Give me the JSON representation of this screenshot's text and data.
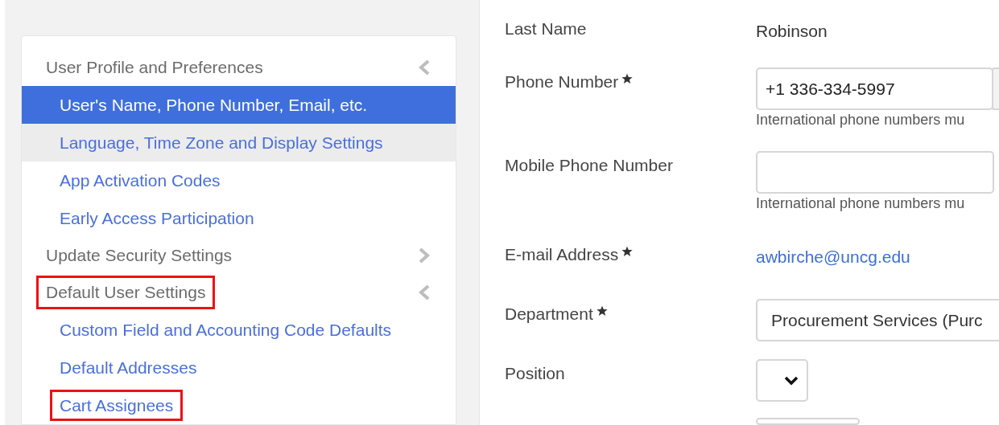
{
  "sidebar": {
    "sections": [
      {
        "title": "User Profile and Preferences",
        "expanded": true,
        "outlined": false,
        "items": [
          {
            "label": "User's Name, Phone Number, Email, etc.",
            "selected": true,
            "hovered": false,
            "outlined": false
          },
          {
            "label": "Language, Time Zone and Display Settings",
            "selected": false,
            "hovered": true,
            "outlined": false
          },
          {
            "label": "App Activation Codes",
            "selected": false,
            "hovered": false,
            "outlined": false
          },
          {
            "label": "Early Access Participation",
            "selected": false,
            "hovered": false,
            "outlined": false
          }
        ]
      },
      {
        "title": "Update Security Settings",
        "expanded": false,
        "outlined": false
      },
      {
        "title": "Default User Settings",
        "expanded": true,
        "outlined": true,
        "items": [
          {
            "label": "Custom Field and Accounting Code Defaults",
            "selected": false,
            "hovered": false,
            "outlined": false
          },
          {
            "label": "Default Addresses",
            "selected": false,
            "hovered": false,
            "outlined": false
          },
          {
            "label": "Cart Assignees",
            "selected": false,
            "hovered": false,
            "outlined": true
          }
        ]
      }
    ]
  },
  "form": {
    "fields": [
      {
        "kind": "text",
        "label": "Last Name",
        "value": "Robinson"
      },
      {
        "kind": "phone",
        "label": "Phone Number",
        "required": true,
        "value": "+1 336-334-5997",
        "help": "International phone numbers mu"
      },
      {
        "kind": "phone",
        "label": "Mobile Phone Number",
        "help": "International phone numbers mu"
      },
      {
        "kind": "link",
        "label": "E-mail Address",
        "required": true,
        "value": "awbirche@uncg.edu"
      },
      {
        "kind": "select",
        "label": "Department",
        "required": true,
        "value": "Procurement Services (Purc"
      },
      {
        "kind": "dropdown",
        "label": "Position"
      },
      {
        "kind": "stub"
      }
    ]
  }
}
